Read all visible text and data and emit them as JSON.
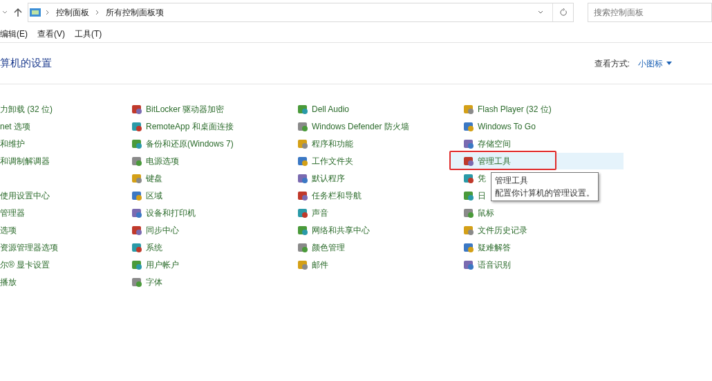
{
  "address_bar": {
    "crumbs": [
      "控制面板",
      "所有控制面板项"
    ]
  },
  "search": {
    "placeholder": "搜索控制面板"
  },
  "menu": [
    "编辑(E)",
    "查看(V)",
    "工具(T)"
  ],
  "heading": "算机的设置",
  "view_by": {
    "label": "查看方式:",
    "value": "小图标"
  },
  "rows": [
    [
      {
        "text": "力卸载 (32 位)",
        "selected": false
      },
      {
        "text": "BitLocker 驱动器加密",
        "selected": false
      },
      {
        "text": "Dell Audio",
        "selected": false
      },
      {
        "text": "Flash Player (32 位)",
        "selected": false
      }
    ],
    [
      {
        "text": "net 选项",
        "selected": false
      },
      {
        "text": "RemoteApp 和桌面连接",
        "selected": false
      },
      {
        "text": "Windows Defender 防火墙",
        "selected": false
      },
      {
        "text": "Windows To Go",
        "selected": false
      }
    ],
    [
      {
        "text": "和维护",
        "selected": false
      },
      {
        "text": "备份和还原(Windows 7)",
        "selected": false
      },
      {
        "text": "程序和功能",
        "selected": false
      },
      {
        "text": "存储空间",
        "selected": false
      }
    ],
    [
      {
        "text": "和调制解调器",
        "selected": false
      },
      {
        "text": "电源选项",
        "selected": false
      },
      {
        "text": "工作文件夹",
        "selected": false
      },
      {
        "text": "管理工具",
        "selected": true
      }
    ],
    [
      null,
      {
        "text": "键盘",
        "selected": false
      },
      {
        "text": "默认程序",
        "selected": false
      },
      {
        "text": "凭",
        "selected": false
      }
    ],
    [
      {
        "text": "使用设置中心",
        "selected": false
      },
      {
        "text": "区域",
        "selected": false
      },
      {
        "text": "任务栏和导航",
        "selected": false
      },
      {
        "text": "日",
        "selected": false
      }
    ],
    [
      {
        "text": "管理器",
        "selected": false
      },
      {
        "text": "设备和打印机",
        "selected": false
      },
      {
        "text": "声音",
        "selected": false
      },
      {
        "text": "鼠标",
        "selected": false
      }
    ],
    [
      {
        "text": "选项",
        "selected": false
      },
      {
        "text": "同步中心",
        "selected": false
      },
      {
        "text": "网络和共享中心",
        "selected": false
      },
      {
        "text": "文件历史记录",
        "selected": false
      }
    ],
    [
      {
        "text": "资源管理器选项",
        "selected": false
      },
      {
        "text": "系统",
        "selected": false
      },
      {
        "text": "颜色管理",
        "selected": false
      },
      {
        "text": "疑难解答",
        "selected": false
      }
    ],
    [
      {
        "text": "尔® 显卡设置",
        "selected": false
      },
      {
        "text": "用户帐户",
        "selected": false
      },
      {
        "text": "邮件",
        "selected": false
      },
      {
        "text": "语音识别",
        "selected": false
      }
    ],
    [
      {
        "text": "播放",
        "selected": false
      },
      {
        "text": "字体",
        "selected": false
      },
      null,
      null
    ]
  ],
  "tooltip": {
    "title": "管理工具",
    "description": "配置你计算机的管理设置。"
  }
}
